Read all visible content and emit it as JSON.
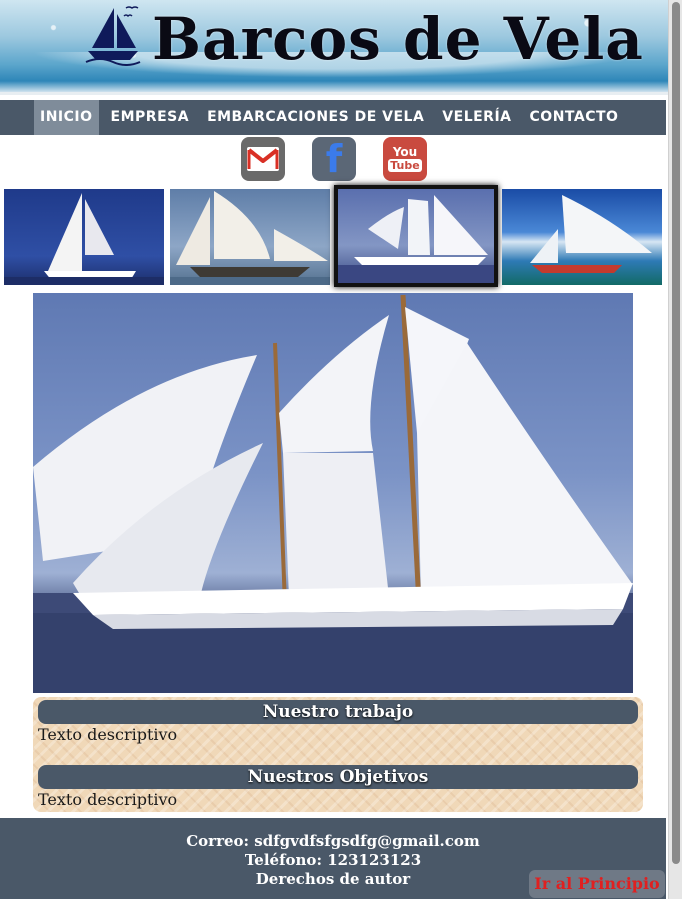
{
  "header": {
    "title": "Barcos de Vela",
    "logo_icon": "sailboat-logo-icon"
  },
  "nav": {
    "items": [
      {
        "label": "INICIO",
        "active": true
      },
      {
        "label": "EMPRESA",
        "active": false
      },
      {
        "label": "EMBARCACIONES DE VELA",
        "active": false
      },
      {
        "label": "VELERÍA",
        "active": false
      },
      {
        "label": "CONTACTO",
        "active": false
      }
    ]
  },
  "social": {
    "youtube_text": "You",
    "youtube_text2": "Tube",
    "facebook_text": "f"
  },
  "sections": [
    {
      "title": "Nuestro trabajo",
      "text": "Texto descriptivo"
    },
    {
      "title": "Nuestros Objetivos",
      "text": "Texto descriptivo"
    }
  ],
  "footer": {
    "email": "Correo: sdfgvdfsfgsdfg@gmail.com",
    "phone": "Teléfono: 123123123",
    "rights": "Derechos de autor"
  },
  "back_to_top": "Ir al Principio",
  "colors": {
    "nav_bg": "#4a5868",
    "nav_active": "#7f8c9a",
    "back_top_text": "#e02020",
    "content_bg": "#f0d8b8"
  }
}
